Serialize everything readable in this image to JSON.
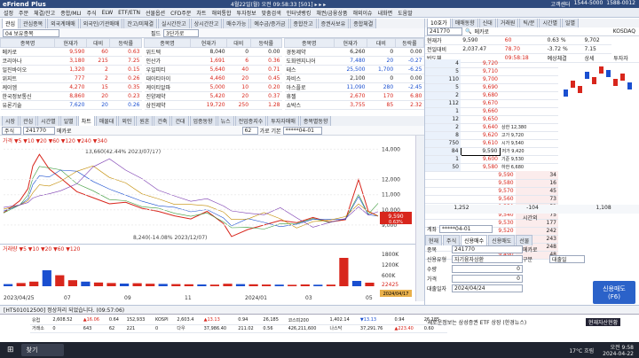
{
  "header": {
    "app": "eFriend Plus",
    "center": "4월22일(월) 오전 09:58:33 [501] ▸ ▸ ▸",
    "right_items": [
      "고객센터",
      "1544-5000",
      "1588-0012"
    ]
  },
  "menu": [
    "설정",
    "주문",
    "체결/잔고",
    "종합/MLI",
    "주식",
    "ELW",
    "ETF/ETN",
    "선물옵션",
    "CFD주문",
    "차트",
    "해외통합",
    "투자정보",
    "맞춤검색",
    "인터넷뱅킹",
    "채권/금융상품",
    "해외이슈",
    "내화면",
    "도움말"
  ],
  "left_tabs": [
    "관심",
    "관심종목",
    "외국계매매",
    "외국인/기관매매",
    "잔고/미체결",
    "실시간잔고",
    "상시간잔고",
    "매수가능",
    "예수금/증거금",
    "종합잔고",
    "증권사보유",
    "종합체결"
  ],
  "selector": {
    "group": "04 보유종목",
    "field_label": "필드",
    "field_value": "3단가로"
  },
  "left_table": {
    "headers": [
      "종목명",
      "현재가",
      "대비",
      "등락률"
    ],
    "rows": [
      [
        "메카로",
        "9,590",
        "60",
        "0.63",
        "up"
      ],
      [
        "코리아나",
        "3,180",
        "215",
        "7.25",
        "up"
      ],
      [
        "일진바이오",
        "1,320",
        "2",
        "0.15",
        "up"
      ],
      [
        "위지트",
        "777",
        "2",
        "0.26",
        "up"
      ],
      [
        "케이엠",
        "4,270",
        "15",
        "0.35",
        "up"
      ],
      [
        "한국정보통신",
        "8,860",
        "20",
        "0.23",
        "up"
      ],
      [
        "유론기술",
        "7,620",
        "20",
        "0.26",
        "dn"
      ]
    ]
  },
  "mid_table": {
    "headers": [
      "종목명",
      "현재가",
      "대비",
      "등락률"
    ],
    "rows": [
      [
        "위드텍",
        "8,040",
        "0",
        "0.00",
        ""
      ],
      [
        "인산가",
        "1,691",
        "6",
        "0.36",
        "up"
      ],
      [
        "우일피티",
        "5,640",
        "40",
        "0.71",
        "up"
      ],
      [
        "대아티아이",
        "4,460",
        "20",
        "0.45",
        "up"
      ],
      [
        "케이티알파",
        "5,000",
        "10",
        "0.20",
        "up"
      ],
      [
        "진양제약",
        "5,420",
        "20",
        "0.37",
        "up"
      ],
      [
        "삼진제약",
        "19,720",
        "250",
        "1.28",
        "up"
      ]
    ]
  },
  "right_table": {
    "headers": [
      "종목명",
      "현재가",
      "대비",
      "등락률"
    ],
    "rows": [
      [
        "경동제약",
        "6,260",
        "0",
        "0.00",
        ""
      ],
      [
        "도화엔지니어",
        "7,480",
        "20",
        "-0.27",
        "dn"
      ],
      [
        "테스",
        "25,500",
        "1,700",
        "-6.25",
        "dn"
      ],
      [
        "자비스",
        "2,100",
        "0",
        "0.00",
        ""
      ],
      [
        "아스플로",
        "11,090",
        "280",
        "-2.45",
        "dn"
      ],
      [
        "휴젤",
        "2,670",
        "170",
        "6.80",
        "up"
      ],
      [
        "쇼박스",
        "3,755",
        "85",
        "2.32",
        "up"
      ]
    ]
  },
  "chart_tabs": [
    "시장",
    "관심",
    "시간별",
    "일별",
    "차트",
    "매물대",
    "외인",
    "원흔",
    "건축",
    "건대",
    "업종동향",
    "뉴스",
    "전업종지수",
    "투자자매매",
    "종목별동향"
  ],
  "chart_toolbar": {
    "type": "주식",
    "code": "241770",
    "name": "메카로",
    "scale_box": "62",
    "right": "가로 기본",
    "extra": "*****04-01"
  },
  "chart_data": [
    {
      "type": "line",
      "title": "",
      "legend": "가격 ▼5 ▼10 ▼20 ▼60 ▼120 ▼240 ▼340",
      "xlabels": [
        "2023/04/25",
        "07",
        "09",
        "11",
        "2024/01",
        "03",
        "05"
      ],
      "y_ticks": [
        "14,000",
        "12,000",
        "11,000",
        "10,000",
        "9,000"
      ],
      "current_price": "9,590",
      "current_change": "0.63%",
      "annotations": {
        "high": "13,660(42.44% 2023/07/17)",
        "low": "8,240(-14.08% 2023/12/07)"
      },
      "points": [
        [
          0,
          9800
        ],
        [
          5,
          10200
        ],
        [
          10,
          10600
        ],
        [
          15,
          11400
        ],
        [
          18,
          12900
        ],
        [
          22,
          13660
        ],
        [
          28,
          12700
        ],
        [
          35,
          12100
        ],
        [
          45,
          11200
        ],
        [
          55,
          10800
        ],
        [
          65,
          10400
        ],
        [
          75,
          10500
        ],
        [
          85,
          10100
        ],
        [
          95,
          9900
        ],
        [
          105,
          9600
        ],
        [
          115,
          9400
        ],
        [
          125,
          9900
        ],
        [
          135,
          9100
        ],
        [
          140,
          8240
        ],
        [
          150,
          8700
        ],
        [
          160,
          9000
        ],
        [
          170,
          9300
        ],
        [
          180,
          9150
        ],
        [
          190,
          9500
        ],
        [
          200,
          9200
        ],
        [
          210,
          9350
        ],
        [
          218,
          12000
        ],
        [
          224,
          9900
        ],
        [
          230,
          9590
        ]
      ]
    },
    {
      "type": "bar",
      "title": "",
      "legend": "거래량 ▼5 ▼10 ▼20 ▼60 ▼120",
      "y_ticks": [
        "1800K",
        "1200K",
        "600K"
      ],
      "current": "22425",
      "values": [
        120,
        180,
        260,
        900,
        620,
        340,
        260,
        210,
        180,
        150,
        170,
        140,
        130,
        120,
        110,
        100,
        90,
        140,
        120,
        110,
        95,
        90,
        80,
        100,
        85,
        90,
        1600,
        300,
        200
      ]
    }
  ],
  "chart_bottom_date": "2024/04/17",
  "right_panel": {
    "tabs": [
      "10호가",
      "매매동향",
      "신대",
      "거래원",
      "틱/분",
      "시간별",
      "일별"
    ],
    "code": "241770",
    "name": "메카로",
    "market": "KOSDAQ",
    "summary": [
      [
        "현재가",
        "9,590",
        "60",
        "0.63 %",
        "9,702"
      ],
      [
        "전일대비",
        "2,037.47",
        "78.70",
        "-3.72 %",
        "7.15"
      ],
      [
        "반도체",
        "",
        "09:58:18",
        "예상체결",
        "상세",
        "투자자"
      ]
    ],
    "orderbook": [
      [
        "4",
        "9,720",
        ""
      ],
      [
        "5",
        "9,710",
        ""
      ],
      [
        "110",
        "9,700",
        ""
      ],
      [
        "5",
        "9,690",
        ""
      ],
      [
        "2",
        "9,680",
        ""
      ],
      [
        "112",
        "9,670",
        ""
      ],
      [
        "1",
        "9,660",
        ""
      ],
      [
        "12",
        "9,650",
        ""
      ],
      [
        "2",
        "9,640",
        "상한 12,380"
      ],
      [
        "8",
        "9,620",
        "고가 9,720"
      ],
      [
        "750",
        "9,610",
        "시가 9,540"
      ],
      [
        "84",
        "9,590",
        "저가 9,420"
      ],
      [
        "1",
        "9,600",
        "기준 9,530"
      ],
      [
        "50",
        "9,580",
        "하한 6,680"
      ]
    ],
    "bid_side": [
      [
        "9,590",
        "34"
      ],
      [
        "9,580",
        "16"
      ],
      [
        "9,570",
        "45"
      ],
      [
        "9,560",
        "73"
      ],
      [
        "9,550",
        "52"
      ],
      [
        "9,540",
        "75"
      ],
      [
        "9,530",
        "177"
      ],
      [
        "9,520",
        "242"
      ],
      [
        "9,510",
        "243"
      ],
      [
        "9,500",
        "248"
      ],
      [
        "9,490",
        "48"
      ]
    ],
    "totals": [
      "1,252",
      "-104",
      "1,108"
    ],
    "time_label": "시간외",
    "account": "*****04-01",
    "order_tabs": [
      "현재",
      "주식",
      "신용매수",
      "신용매도",
      "선물"
    ],
    "order": {
      "stock_code": "241770",
      "stock_name": "메카로",
      "credit_type": "자기융자상환",
      "credit_label": "신용유형",
      "account_type": "구분",
      "kind": "대출일",
      "qty_label": "수량",
      "qty_value": "0",
      "price_label": "가격",
      "price_value": "0",
      "loan_date_label": "대출일자",
      "loan_date": "2024/04/24",
      "sell_label": "신용매도",
      "sell_hotkey": "(F6)"
    }
  },
  "status_msg": "[HTS01012500] 정상처리 되었습니다. (09:57:06)",
  "ticker": {
    "rows": [
      [
        "유럽",
        "2,608.52",
        "▲16.06",
        "0.64",
        "152,933",
        "KOSPI",
        "2,603.4",
        "▲13.13",
        "0.94",
        "26,185",
        "코스피200",
        "1,402.14",
        "▼13.13",
        "0.94",
        "26,185"
      ],
      [
        "거래소",
        "0",
        "643",
        "62",
        "221",
        "0",
        "다우",
        "37,986.40",
        "211.02",
        "0.56",
        "426,211,600",
        "나스닥",
        "37,291.76",
        "▲223.40",
        "0.60"
      ]
    ],
    "right": "현재자산현황",
    "notice": "'새로운정보는 삼성증권 ETF 상장 (한경뉴스)"
  },
  "taskbar": {
    "search": "찾기",
    "weather": "17°C 흐림",
    "time": "오전 9:58",
    "date": "2024-04-22"
  },
  "colors": {
    "up": "#d8261c",
    "down": "#1a4fd0",
    "header": "#2e4a7d"
  }
}
